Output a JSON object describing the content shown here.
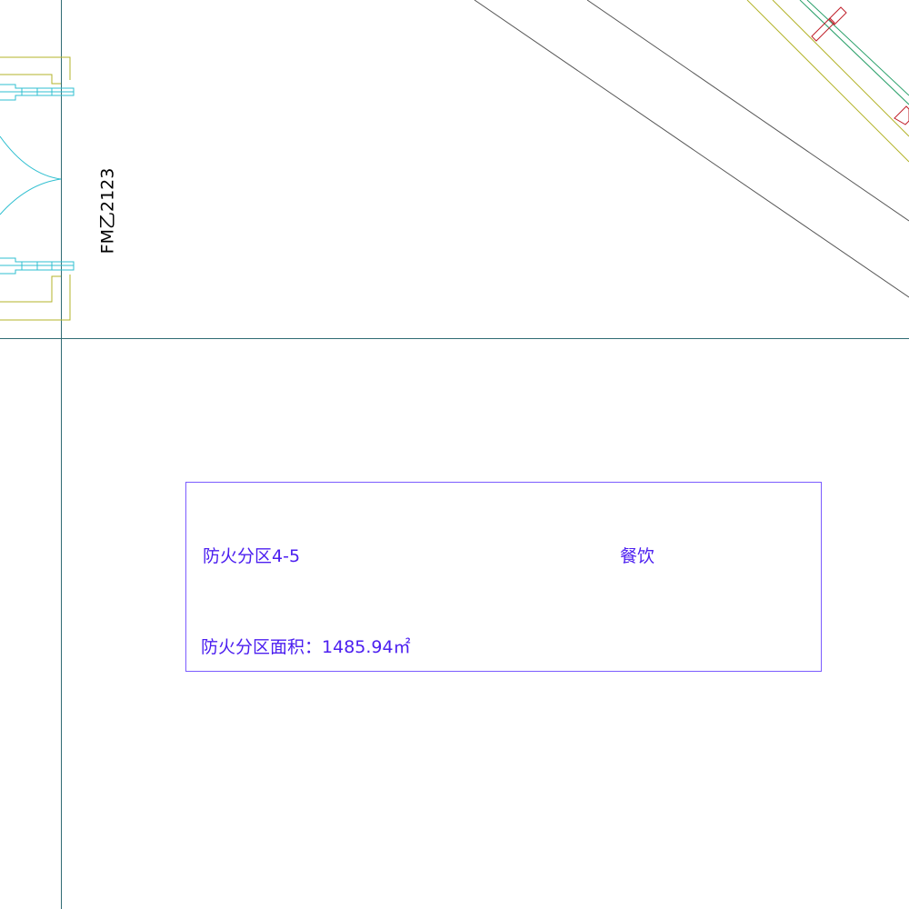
{
  "drawing": {
    "door_tag": "FM乙2123",
    "fire_zone": {
      "name": "防火分区4-5",
      "use": "餐饮",
      "area_label": "防火分区面积：",
      "area_value": "1485.94㎡"
    },
    "colors": {
      "axis_line": "#2f6b73",
      "wall_yellow": "#b3b32a",
      "door_cyan": "#2fbfd0",
      "rail_green": "#2aa06a",
      "fitting_red": "#c0202a",
      "diagonal_gray": "#555555",
      "zone_border": "#7b5cff",
      "zone_text": "#4c1ff0",
      "tag_text": "#000000"
    }
  }
}
